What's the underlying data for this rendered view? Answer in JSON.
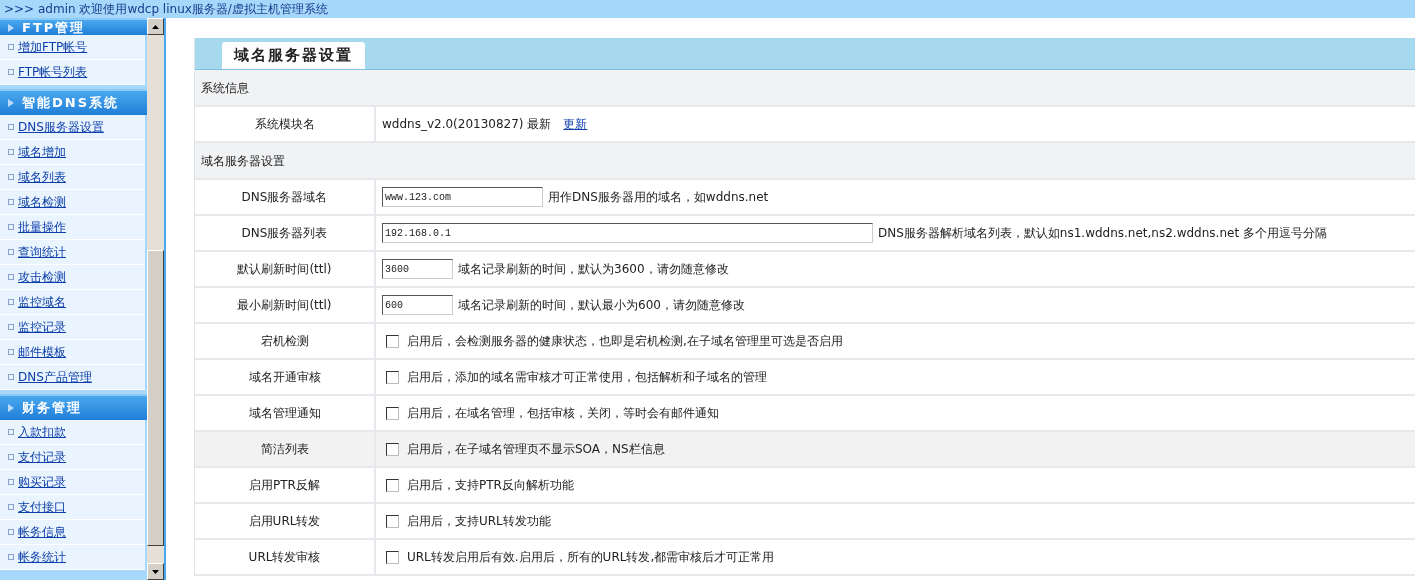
{
  "top_bar": {
    "title": ">>> admin 欢迎使用wdcp linux服务器/虚拟主机管理系统"
  },
  "sidebar": {
    "groups": [
      {
        "title": "FTP管理",
        "items": [
          "增加FTP帐号",
          "FTP帐号列表"
        ]
      },
      {
        "title": "智能DNS系统",
        "items": [
          "DNS服务器设置",
          "域名增加",
          "域名列表",
          "域名检测",
          "批量操作",
          "查询统计",
          "攻击检测",
          "监控域名",
          "监控记录",
          "邮件模板",
          "DNS产品管理"
        ]
      },
      {
        "title": "财务管理",
        "items": [
          "入款扣款",
          "支付记录",
          "购买记录",
          "支付接口",
          "帐务信息",
          "帐务统计"
        ]
      }
    ]
  },
  "panel": {
    "tab": "域名服务器设置",
    "sections": [
      {
        "title": "系统信息",
        "rows": [
          {
            "kind": "info",
            "label": "系统模块名",
            "value": "wddns_v2.0(20130827) 最新",
            "link": "更新",
            "highlighted": false
          }
        ]
      },
      {
        "title": "域名服务器设置",
        "rows": [
          {
            "kind": "input",
            "label": "DNS服务器域名",
            "value": "www.123.com",
            "wide": false,
            "note": "用作DNS服务器用的域名，如wddns.net",
            "highlighted": false
          },
          {
            "kind": "input",
            "label": "DNS服务器列表",
            "value": "192.168.0.1",
            "wide": true,
            "note": "DNS服务器解析域名列表，默认如ns1.wddns.net,ns2.wddns.net 多个用逗号分隔",
            "highlighted": false
          },
          {
            "kind": "short",
            "label": "默认刷新时间(ttl)",
            "value": "3600",
            "note": "域名记录刷新的时间，默认为3600，请勿随意修改",
            "highlighted": false
          },
          {
            "kind": "short",
            "label": "最小刷新时间(ttl)",
            "value": "600",
            "note": "域名记录刷新的时间，默认最小为600，请勿随意修改",
            "highlighted": false
          },
          {
            "kind": "checkbox",
            "label": "宕机检测",
            "checked": false,
            "note": "启用后，会检测服务器的健康状态，也即是宕机检测,在子域名管理里可选是否启用",
            "highlighted": false
          },
          {
            "kind": "checkbox",
            "label": "域名开通审核",
            "checked": false,
            "note": "启用后，添加的域名需审核才可正常使用，包括解析和子域名的管理",
            "highlighted": false
          },
          {
            "kind": "checkbox",
            "label": "域名管理通知",
            "checked": false,
            "note": "启用后，在域名管理，包括审核，关闭，等时会有邮件通知",
            "highlighted": false
          },
          {
            "kind": "checkbox",
            "label": "简洁列表",
            "checked": false,
            "note": "启用后，在子域名管理页不显示SOA，NS栏信息",
            "highlighted": true
          },
          {
            "kind": "checkbox",
            "label": "启用PTR反解",
            "checked": false,
            "note": "启用后，支持PTR反向解析功能",
            "highlighted": false
          },
          {
            "kind": "checkbox",
            "label": "启用URL转发",
            "checked": false,
            "note": "启用后，支持URL转发功能",
            "highlighted": false
          },
          {
            "kind": "checkbox",
            "label": "URL转发审核",
            "checked": false,
            "note": "URL转发启用后有效.启用后，所有的URL转发,都需审核后才可正常用",
            "highlighted": false
          }
        ]
      }
    ]
  }
}
